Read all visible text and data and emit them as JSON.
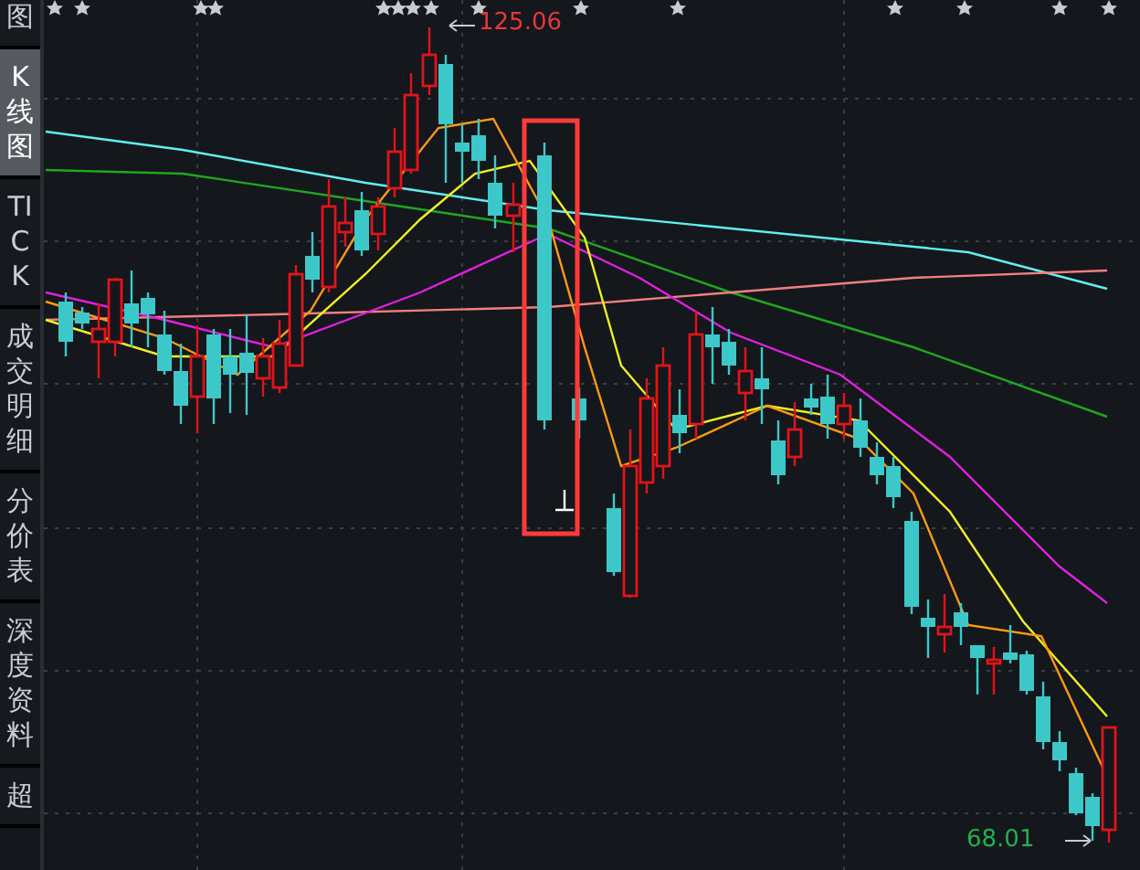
{
  "sidebar": {
    "tabs": [
      {
        "label": "图",
        "selected": false
      },
      {
        "label": "K线图",
        "selected": true
      },
      {
        "label": "TICK",
        "selected": false
      },
      {
        "label": "成交明细",
        "selected": false
      },
      {
        "label": "分价表",
        "selected": false
      },
      {
        "label": "深度资料",
        "selected": false
      },
      {
        "label": "超",
        "selected": false
      }
    ]
  },
  "chart": {
    "high_label": "125.06",
    "low_label": "68.01"
  }
}
